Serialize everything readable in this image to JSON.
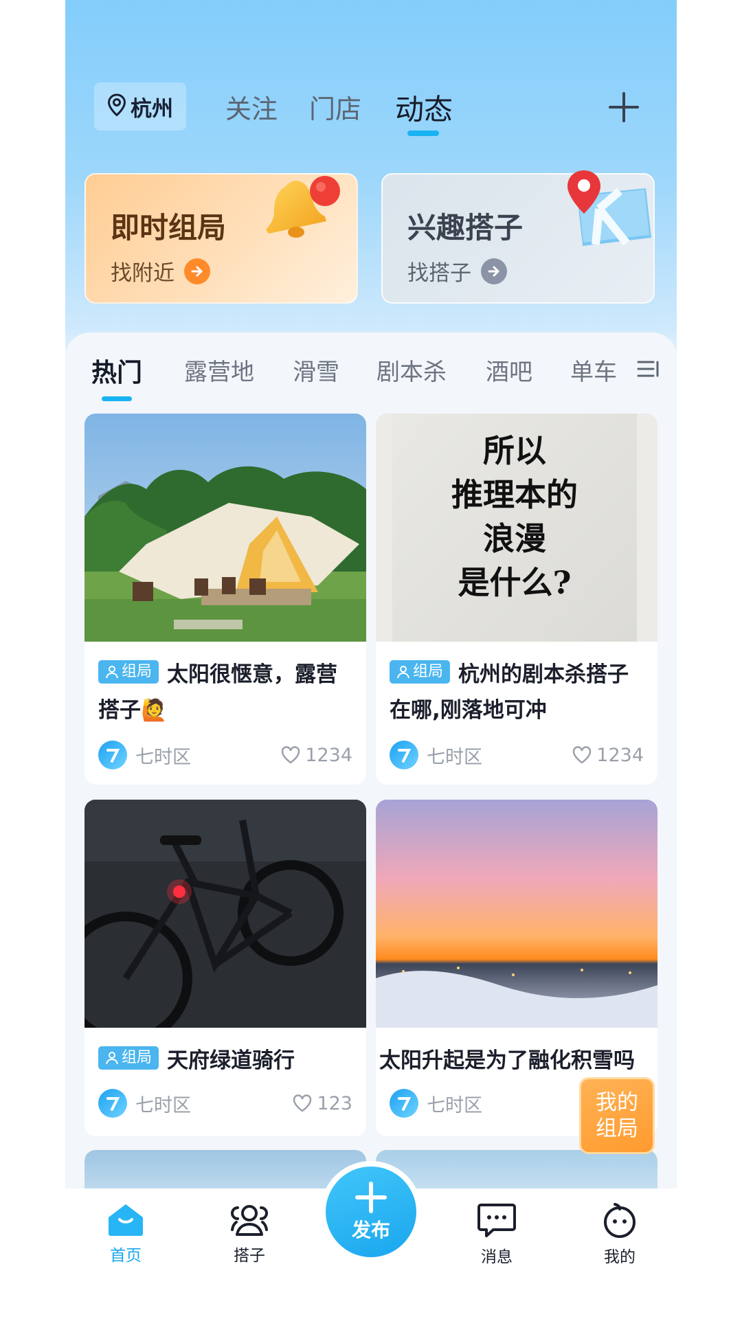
{
  "header": {
    "city": "杭州",
    "tabs": [
      {
        "label": "关注",
        "active": false
      },
      {
        "label": "门店",
        "active": false
      },
      {
        "label": "动态",
        "active": true
      }
    ],
    "add_icon": "plus-icon"
  },
  "promos": [
    {
      "title": "即时组局",
      "subtitle": "找附近",
      "icon": "bell-icon",
      "accent": "#ff8a2a"
    },
    {
      "title": "兴趣搭子",
      "subtitle": "找搭子",
      "icon": "map-pin-icon",
      "accent": "#8a94a6"
    }
  ],
  "categories": [
    "热门",
    "露营地",
    "滑雪",
    "剧本杀",
    "酒吧",
    "单车"
  ],
  "active_category": "热门",
  "posts": [
    {
      "tag": "组局",
      "title": "太阳很惬意，露营搭子🙋",
      "author": "七时区",
      "likes": "1234",
      "image": "camping-tent"
    },
    {
      "tag": "组局",
      "title": "杭州的剧本杀搭子在哪,刚落地可冲",
      "author": "七时区",
      "likes": "1234",
      "image": "script-poster",
      "image_text": [
        "所以",
        "推理本的",
        "浪漫",
        "是什么?"
      ]
    },
    {
      "tag": "组局",
      "title": "天府绿道骑行",
      "author": "七时区",
      "likes": "123",
      "image": "bicycle-night"
    },
    {
      "tag": "",
      "title": "太阳升起是为了融化积雪吗",
      "author": "七时区",
      "likes": "",
      "image": "snowy-sunset"
    }
  ],
  "floating_button": "我的组局",
  "bottom_nav": [
    {
      "label": "首页",
      "icon": "home-icon",
      "active": true
    },
    {
      "label": "搭子",
      "icon": "people-icon",
      "active": false
    },
    {
      "label": "发布",
      "icon": "plus-icon",
      "active": false
    },
    {
      "label": "消息",
      "icon": "message-icon",
      "active": false
    },
    {
      "label": "我的",
      "icon": "profile-icon",
      "active": false
    }
  ],
  "colors": {
    "accent": "#19b3f4",
    "orange": "#ff9b2f",
    "tag": "#4ab5ef"
  }
}
